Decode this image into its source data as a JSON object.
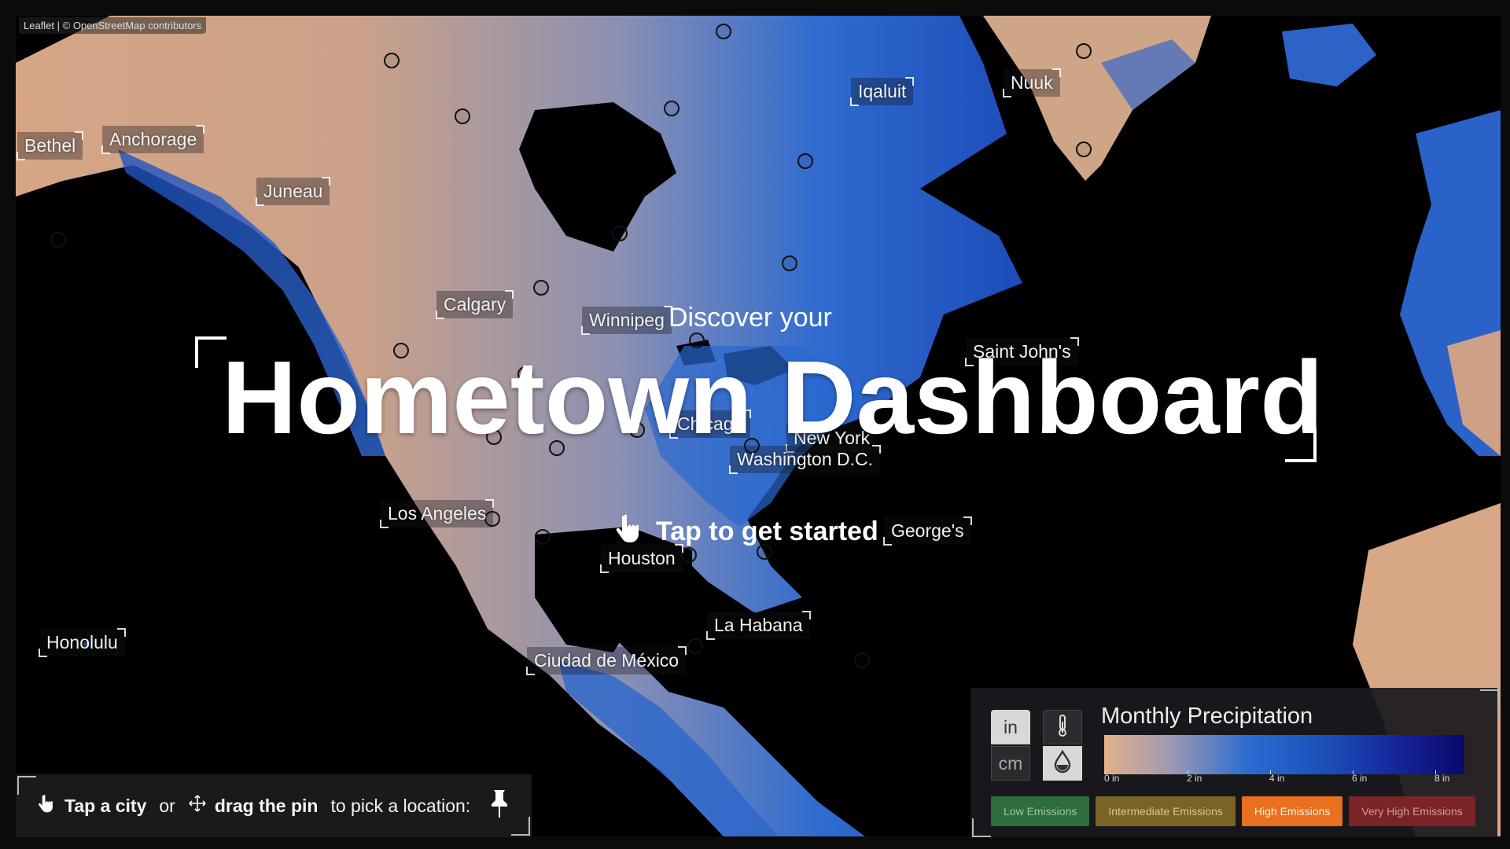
{
  "attribution": "Leaflet | © OpenStreetMap contributors",
  "hero": {
    "subtitle": "Discover your",
    "title": "Hometown Dashboard",
    "cta": "Tap to get started"
  },
  "cities": [
    {
      "name": "Bethel"
    },
    {
      "name": "Anchorage"
    },
    {
      "name": "Juneau"
    },
    {
      "name": "Iqaluit"
    },
    {
      "name": "Nuuk"
    },
    {
      "name": "Calgary"
    },
    {
      "name": "Winnipeg"
    },
    {
      "name": "Saint John's"
    },
    {
      "name": "Chicago"
    },
    {
      "name": "New York"
    },
    {
      "name": "Washington D.C."
    },
    {
      "name": "Los Angeles"
    },
    {
      "name": "George's"
    },
    {
      "name": "Houston"
    },
    {
      "name": "La Habana"
    },
    {
      "name": "Ciudad de México"
    },
    {
      "name": "Honolulu"
    }
  ],
  "pick_bar": {
    "tap_label": "Tap a city",
    "or_label": "or",
    "drag_label": "drag the pin",
    "suffix": "to pick a location:"
  },
  "legend": {
    "units": [
      "in",
      "cm"
    ],
    "selected_unit": "in",
    "selected_variable": "precipitation",
    "title": "Monthly Precipitation",
    "ticks": [
      "0 in",
      "2 in",
      "4 in",
      "6 in",
      "8 in"
    ],
    "emissions": [
      "Low Emissions",
      "Intermediate Emissions",
      "High Emissions",
      "Very High Emissions"
    ],
    "selected_emission": "High Emissions",
    "colors": {
      "low": "#e3b08a",
      "mid": "#2a6cd2",
      "high": "#08096a",
      "emission_low": "#2e6d3d",
      "emission_intermediate": "#7a6425",
      "emission_high": "#e8701f",
      "emission_very_high": "#7a2427"
    }
  },
  "icons": {
    "cta": "hand-pointer-icon",
    "tap": "hand-pointer-icon",
    "drag": "move-arrows-icon",
    "pin": "pushpin-icon",
    "temperature": "thermometer-icon",
    "precipitation": "droplet-icon"
  }
}
